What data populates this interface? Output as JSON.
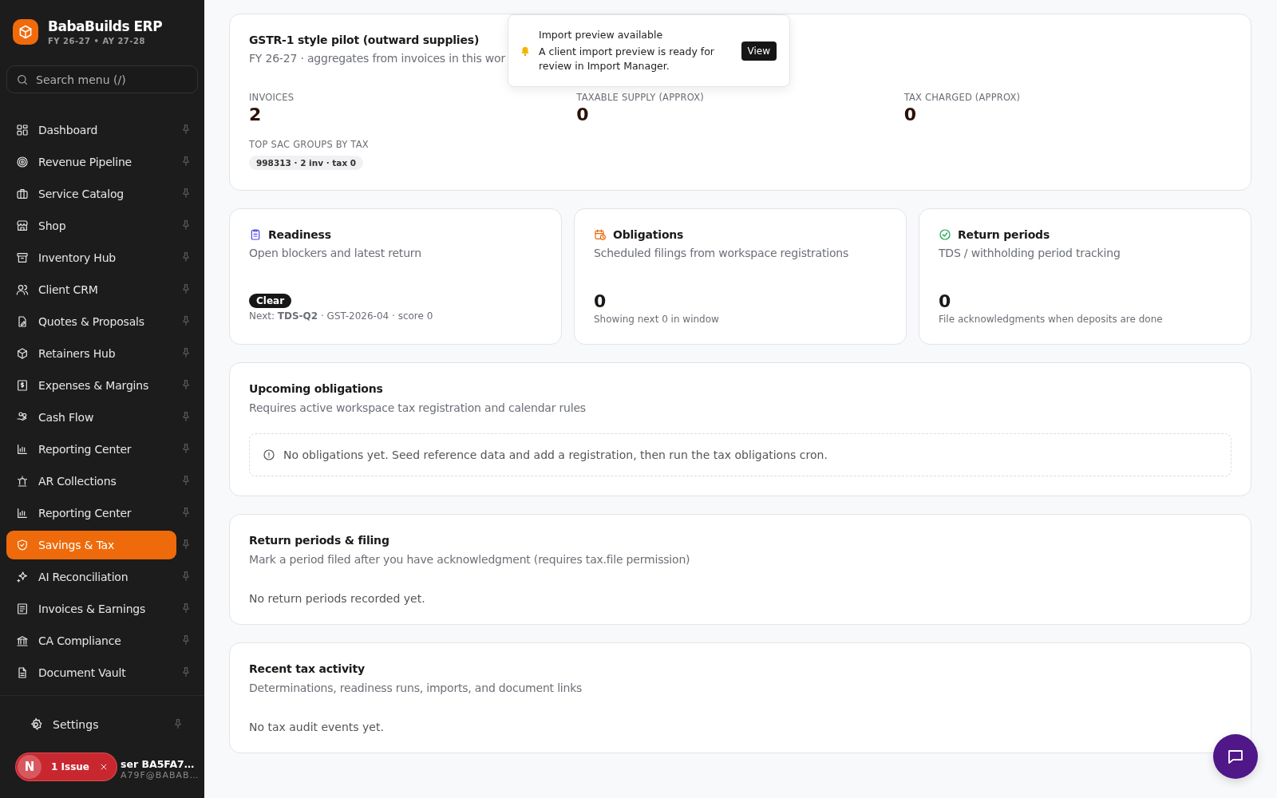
{
  "brand": {
    "name": "BabaBuilds ERP",
    "subtitle": "FY 26-27 • AY 27-28"
  },
  "search": {
    "placeholder": "Search menu (/)"
  },
  "nav": [
    {
      "label": "Dashboard",
      "selected": false
    },
    {
      "label": "Revenue Pipeline",
      "selected": false
    },
    {
      "label": "Service Catalog",
      "selected": false
    },
    {
      "label": "Shop",
      "selected": false
    },
    {
      "label": "Inventory Hub",
      "selected": false
    },
    {
      "label": "Client CRM",
      "selected": false
    },
    {
      "label": "Quotes & Proposals",
      "selected": false
    },
    {
      "label": "Retainers Hub",
      "selected": false
    },
    {
      "label": "Expenses & Margins",
      "selected": false
    },
    {
      "label": "Cash Flow",
      "selected": false
    },
    {
      "label": "Reporting Center",
      "selected": false
    },
    {
      "label": "AR Collections",
      "selected": false
    },
    {
      "label": "Reporting Center",
      "selected": false
    },
    {
      "label": "Savings & Tax",
      "selected": true
    },
    {
      "label": "AI Reconciliation",
      "selected": false
    },
    {
      "label": "Invoices & Earnings",
      "selected": false
    },
    {
      "label": "CA Compliance",
      "selected": false
    },
    {
      "label": "Document Vault",
      "selected": false
    }
  ],
  "settings": {
    "label": "Settings"
  },
  "user": {
    "name": "ser BA5FA7…",
    "email": "A79F@BABAB…"
  },
  "issue_badge": {
    "avatar": "N",
    "label": "1 Issue"
  },
  "gstr": {
    "title": "GSTR-1 style pilot (outward supplies)",
    "subtitle": "FY 26-27 · aggregates from invoices in this wor",
    "stats": [
      {
        "label": "INVOICES",
        "value": "2"
      },
      {
        "label": "TAXABLE SUPPLY (APPROX)",
        "value": "0"
      },
      {
        "label": "TAX CHARGED (APPROX)",
        "value": "0"
      }
    ],
    "groups_label": "TOP SAC GROUPS BY TAX",
    "groups": [
      "998313 · 2 inv · tax 0"
    ]
  },
  "summary_cards": [
    {
      "title": "Readiness",
      "subtitle": "Open blockers and latest return",
      "status": "Clear",
      "note": "Next: **TDS-Q2** · GST-2026-04 · score 0"
    },
    {
      "title": "Obligations",
      "subtitle": "Scheduled filings from workspace registrations",
      "value": "0",
      "note": "Showing next 0 in window"
    },
    {
      "title": "Return periods",
      "subtitle": "TDS / withholding period tracking",
      "value": "0",
      "note": "File acknowledgments when deposits are done"
    }
  ],
  "sections": [
    {
      "kind": "notice",
      "title": "Upcoming obligations",
      "subtitle": "Requires active workspace tax registration and calendar rules",
      "message": "No obligations yet. Seed reference data and add a registration, then run the tax obligations cron."
    },
    {
      "kind": "plain",
      "title": "Return periods & filing",
      "subtitle": "Mark a period filed after you have acknowledgment (requires tax.file permission)",
      "message": "No return periods recorded yet."
    },
    {
      "kind": "plain",
      "title": "Recent tax activity",
      "subtitle": "Determinations, readiness runs, imports, and document links",
      "message": "No tax audit events yet."
    }
  ],
  "toast": {
    "title": "Import preview available",
    "message": "A client import preview is ready for review in Import Manager.",
    "action": "View"
  }
}
